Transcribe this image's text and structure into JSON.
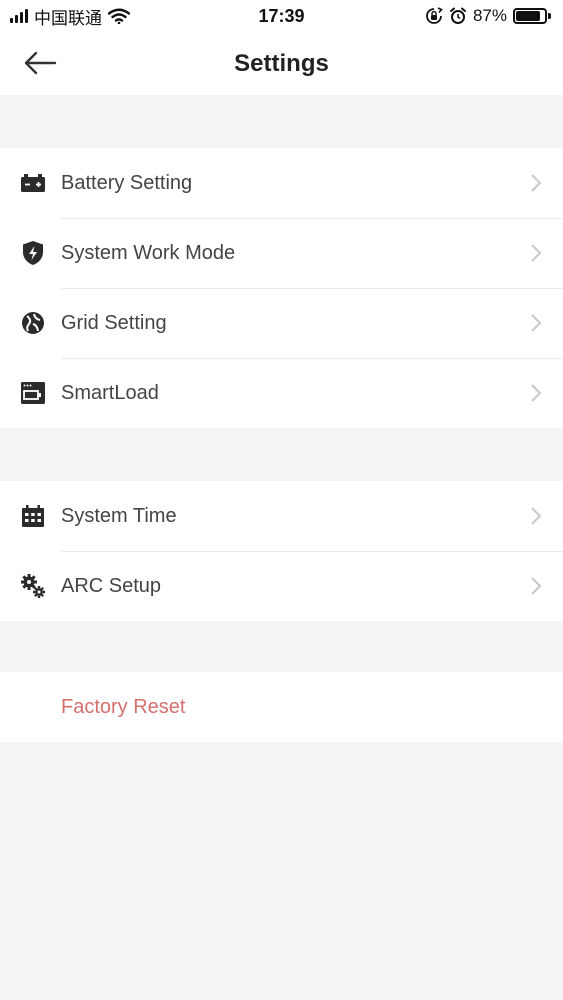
{
  "status_bar": {
    "carrier": "中国联通",
    "time": "17:39",
    "battery_percent": "87%",
    "battery_level": 0.87
  },
  "nav": {
    "title": "Settings"
  },
  "groups": [
    {
      "items": [
        {
          "label": "Battery Setting",
          "icon": "battery-icon"
        },
        {
          "label": "System Work Mode",
          "icon": "shield-bolt-icon"
        },
        {
          "label": "Grid Setting",
          "icon": "grid-globe-icon"
        },
        {
          "label": "SmartLoad",
          "icon": "window-toggle-icon"
        }
      ]
    },
    {
      "items": [
        {
          "label": "System Time",
          "icon": "calendar-icon"
        },
        {
          "label": "ARC Setup",
          "icon": "gears-icon"
        }
      ]
    }
  ],
  "factory_reset": {
    "label": "Factory Reset",
    "color": "#d6706d"
  },
  "colors": {
    "background": "#f4f4f6",
    "surface": "#ffffff",
    "divider": "#ececec",
    "chevron": "#c8c8c8"
  }
}
